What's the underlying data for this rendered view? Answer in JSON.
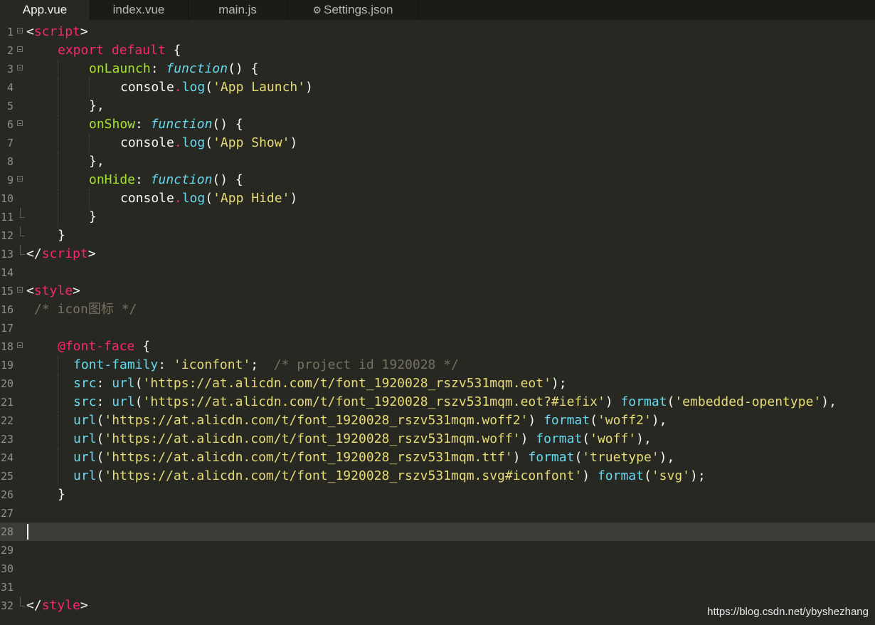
{
  "tabs": [
    {
      "label": "App.vue"
    },
    {
      "label": "index.vue"
    },
    {
      "label": "main.js"
    },
    {
      "label": "Settings.json"
    }
  ],
  "gutter": {
    "line_numbers": [
      "1",
      "2",
      "3",
      "4",
      "5",
      "6",
      "7",
      "8",
      "9",
      "10",
      "11",
      "12",
      "13",
      "14",
      "15",
      "16",
      "17",
      "18",
      "19",
      "20",
      "21",
      "22",
      "23",
      "24",
      "25",
      "26",
      "27",
      "28",
      "29",
      "30",
      "31",
      "32"
    ]
  },
  "code": {
    "l1": [
      "<",
      "script",
      ">"
    ],
    "l2": [
      "export",
      " ",
      "default",
      " {"
    ],
    "l3": [
      "onLaunch",
      ": ",
      "function",
      "() {"
    ],
    "l4": [
      "console",
      ".",
      "log",
      "(",
      "'App Launch'",
      ")"
    ],
    "l5": [
      "},"
    ],
    "l6": [
      "onShow",
      ": ",
      "function",
      "() {"
    ],
    "l7": [
      "console",
      ".",
      "log",
      "(",
      "'App Show'",
      ")"
    ],
    "l8": [
      "},"
    ],
    "l9": [
      "onHide",
      ": ",
      "function",
      "() {"
    ],
    "l10": [
      "console",
      ".",
      "log",
      "(",
      "'App Hide'",
      ")"
    ],
    "l11": [
      "}"
    ],
    "l12": [
      "}"
    ],
    "l13": [
      "</",
      "script",
      ">"
    ],
    "l15": [
      "<",
      "style",
      ">"
    ],
    "l16": [
      "/* icon图标 */"
    ],
    "l18": [
      "@font-face",
      " {"
    ],
    "l19": [
      "font-family",
      ": ",
      "'iconfont'",
      ";  ",
      "/* project id 1920028 */"
    ],
    "l20": [
      "src",
      ": ",
      "url",
      "(",
      "'https://at.alicdn.com/t/font_1920028_rszv531mqm.eot'",
      ");"
    ],
    "l21": [
      "src",
      ": ",
      "url",
      "(",
      "'https://at.alicdn.com/t/font_1920028_rszv531mqm.eot?#iefix'",
      ") ",
      "format",
      "(",
      "'embedded-opentype'",
      "),"
    ],
    "l22": [
      "url",
      "(",
      "'https://at.alicdn.com/t/font_1920028_rszv531mqm.woff2'",
      ") ",
      "format",
      "(",
      "'woff2'",
      "),"
    ],
    "l23": [
      "url",
      "(",
      "'https://at.alicdn.com/t/font_1920028_rszv531mqm.woff'",
      ") ",
      "format",
      "(",
      "'woff'",
      "),"
    ],
    "l24": [
      "url",
      "(",
      "'https://at.alicdn.com/t/font_1920028_rszv531mqm.ttf'",
      ") ",
      "format",
      "(",
      "'truetype'",
      "),"
    ],
    "l25": [
      "url",
      "(",
      "'https://at.alicdn.com/t/font_1920028_rszv531mqm.svg#iconfont'",
      ") ",
      "format",
      "(",
      "'svg'",
      ");"
    ],
    "l26": [
      "}"
    ],
    "l32": [
      "</",
      "style",
      ">"
    ]
  },
  "watermark": "https://blog.csdn.net/ybyshezhang",
  "theme": {
    "background": "#272822",
    "tag": "#f92672",
    "function_name": "#a6e22e",
    "storage": "#66d9ef",
    "string": "#e6db74",
    "comment": "#75715e"
  }
}
